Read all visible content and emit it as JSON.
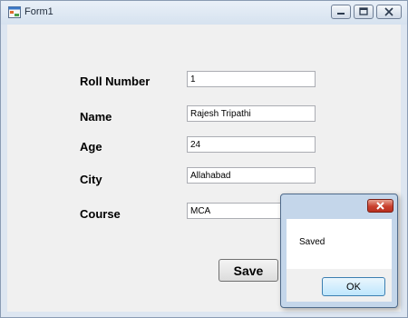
{
  "window": {
    "title": "Form1",
    "icon": "form-app-icon",
    "controls": [
      "minimize-icon",
      "maximize-icon",
      "close-icon"
    ]
  },
  "form": {
    "roll_number_label": "Roll Number",
    "roll_number_value": "1",
    "name_label": "Name",
    "name_value": "Rajesh Tripathi",
    "age_label": "Age",
    "age_value": "24",
    "city_label": "City",
    "city_value": "Allahabad",
    "course_label": "Course",
    "course_value": "MCA",
    "save_label": "Save"
  },
  "message_box": {
    "message": "Saved",
    "ok_label": "OK",
    "close_icon": "close-icon"
  },
  "colors": {
    "window_frame": "#dde6f1",
    "client_bg": "#f0f0f0",
    "close_button_red": "#c9402e",
    "ok_button_blue": "#bee6fd"
  }
}
